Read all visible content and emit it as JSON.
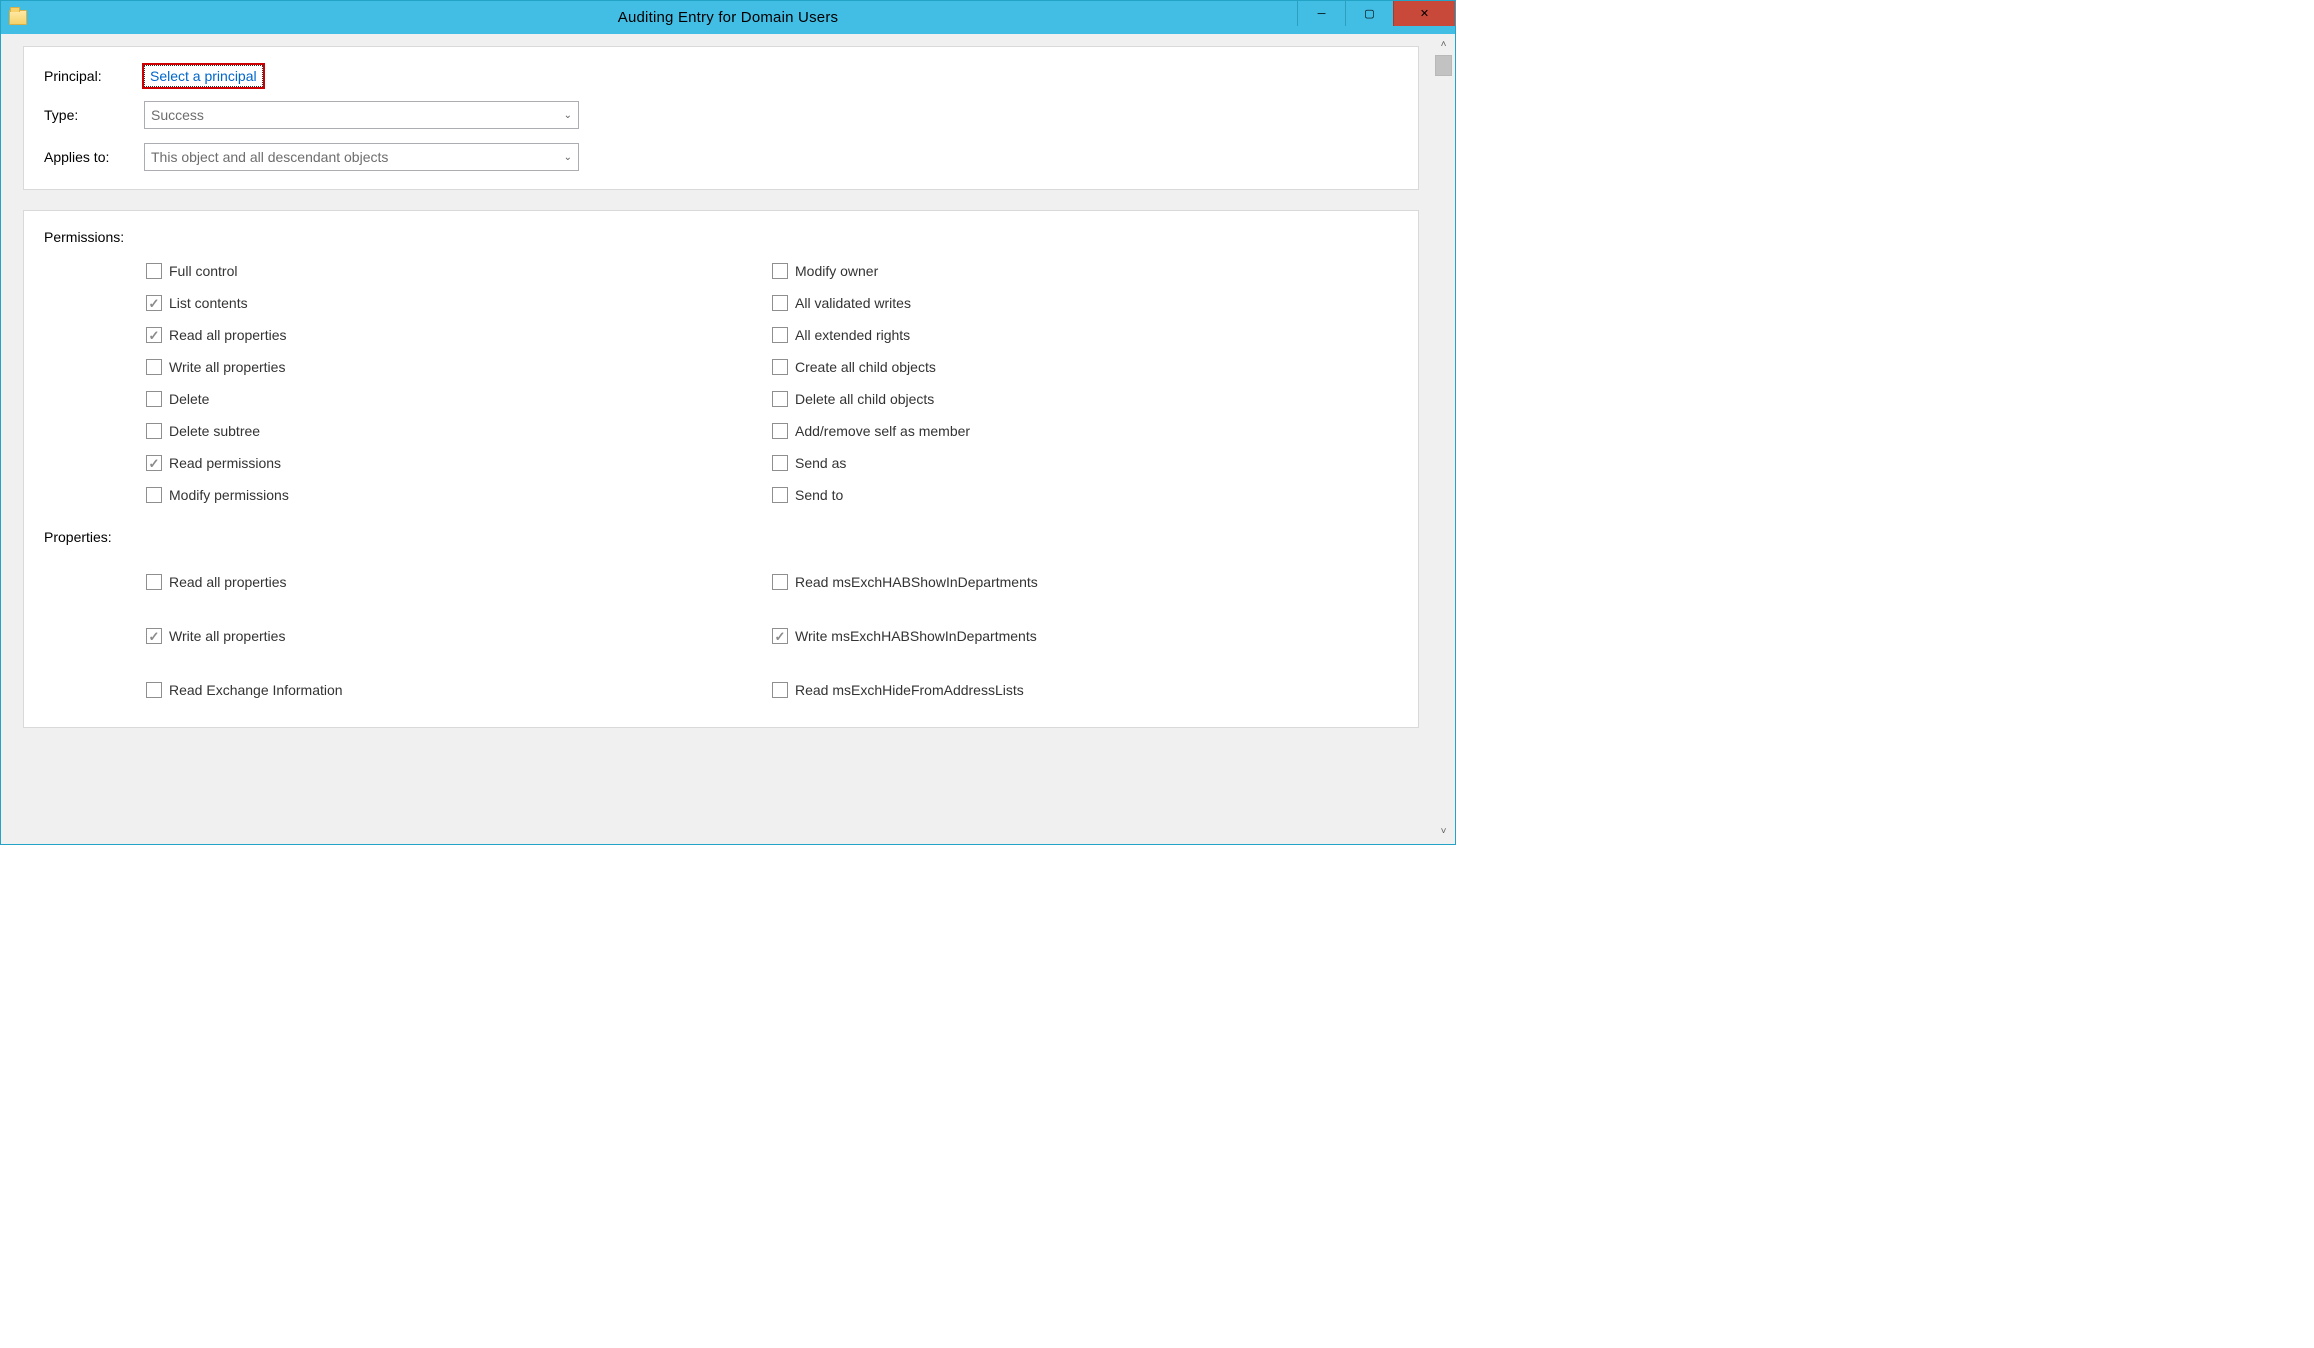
{
  "titlebar": {
    "title": "Auditing Entry for Domain Users"
  },
  "header": {
    "principal_label": "Principal:",
    "principal_link": "Select a principal",
    "type_label": "Type:",
    "type_value": "Success",
    "applies_label": "Applies to:",
    "applies_value": "This object and all descendant objects"
  },
  "sections": {
    "permissions_title": "Permissions:",
    "properties_title": "Properties:"
  },
  "perm_left": [
    {
      "label": "Full control",
      "checked": false
    },
    {
      "label": "List contents",
      "checked": true
    },
    {
      "label": "Read all properties",
      "checked": true
    },
    {
      "label": "Write all properties",
      "checked": false
    },
    {
      "label": "Delete",
      "checked": false
    },
    {
      "label": "Delete subtree",
      "checked": false
    },
    {
      "label": "Read permissions",
      "checked": true
    },
    {
      "label": "Modify permissions",
      "checked": false
    }
  ],
  "perm_right": [
    {
      "label": "Modify owner",
      "checked": false
    },
    {
      "label": "All validated writes",
      "checked": false
    },
    {
      "label": "All extended rights",
      "checked": false
    },
    {
      "label": "Create all child objects",
      "checked": false
    },
    {
      "label": "Delete all child objects",
      "checked": false
    },
    {
      "label": "Add/remove self as member",
      "checked": false
    },
    {
      "label": "Send as",
      "checked": false
    },
    {
      "label": "Send to",
      "checked": false
    }
  ],
  "prop_left": [
    {
      "label": "Read all properties",
      "checked": false
    },
    {
      "label": "Write all properties",
      "checked": true
    },
    {
      "label": "Read Exchange Information",
      "checked": false
    }
  ],
  "prop_right": [
    {
      "label": "Read msExchHABShowInDepartments",
      "checked": false
    },
    {
      "label": "Write msExchHABShowInDepartments",
      "checked": true
    },
    {
      "label": "Read msExchHideFromAddressLists",
      "checked": false
    }
  ]
}
